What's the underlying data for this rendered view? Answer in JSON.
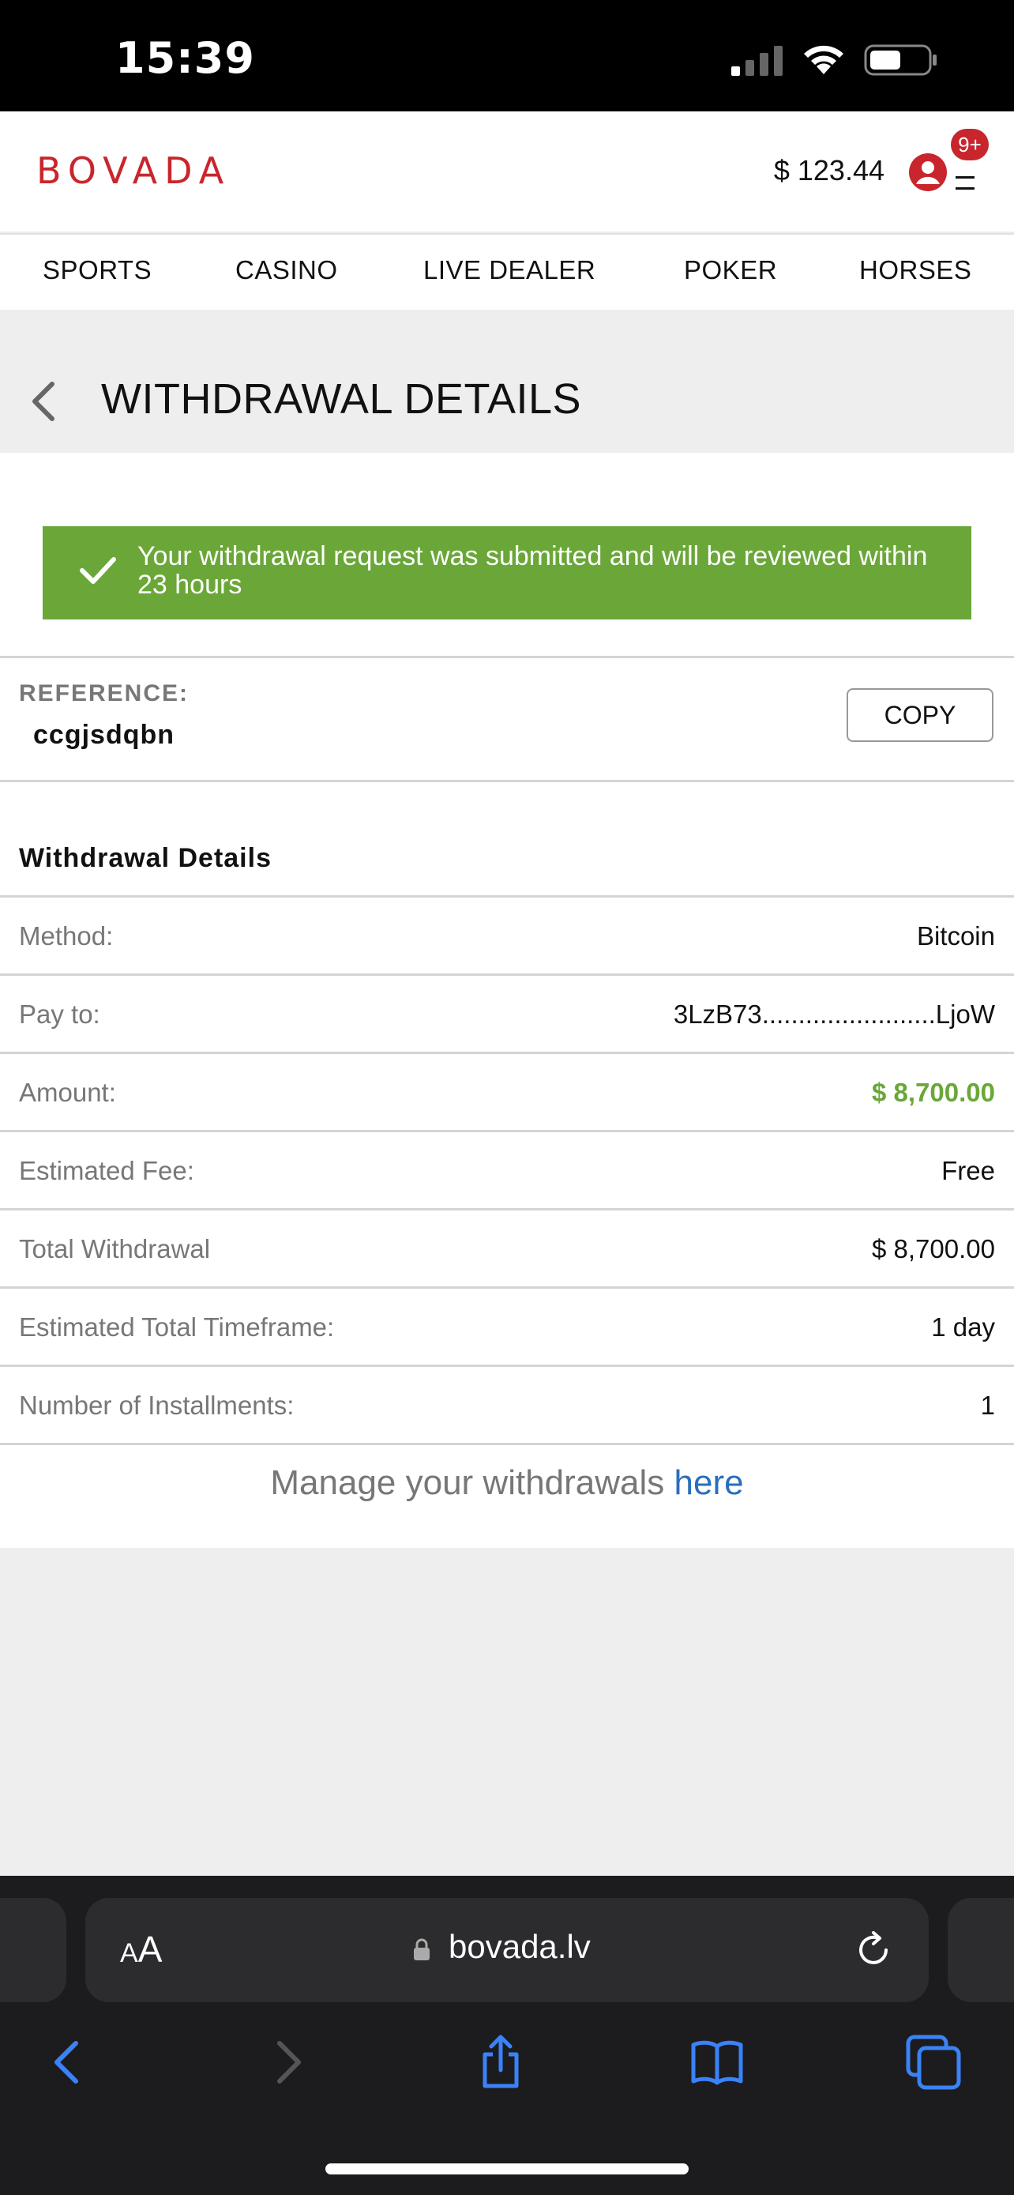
{
  "status_bar": {
    "time": "15:39",
    "icons": [
      "signal-icon",
      "wifi-icon",
      "battery-icon"
    ]
  },
  "header": {
    "logo": "BOVADA",
    "balance": "$ 123.44",
    "notification_badge": "9+",
    "brand_color": "#c8262c"
  },
  "nav": {
    "items": [
      {
        "label": "SPORTS"
      },
      {
        "label": "CASINO"
      },
      {
        "label": "LIVE DEALER"
      },
      {
        "label": "POKER"
      },
      {
        "label": "HORSES"
      }
    ]
  },
  "page": {
    "title": "WITHDRAWAL DETAILS"
  },
  "banner": {
    "message": "Your withdrawal request was submitted and will be reviewed within 23 hours",
    "color": "#6aa738"
  },
  "reference": {
    "label": "REFERENCE:",
    "value": "ccgjsdqbn",
    "copy_label": "COPY"
  },
  "details": {
    "heading": "Withdrawal Details",
    "rows": [
      {
        "label": "Method:",
        "value": "Bitcoin"
      },
      {
        "label": "Pay to:",
        "value": "3LzB73........................LjoW"
      },
      {
        "label": "Amount:",
        "value": "$ 8,700.00"
      },
      {
        "label": "Estimated Fee:",
        "value": "Free"
      },
      {
        "label": "Total Withdrawal",
        "value": "$ 8,700.00"
      },
      {
        "label": "Estimated Total Timeframe:",
        "value": "1 day"
      },
      {
        "label": "Number of Installments:",
        "value": "1"
      }
    ]
  },
  "manage": {
    "text": "Manage your withdrawals",
    "link": "here"
  },
  "safari": {
    "aa_small": "A",
    "aa_large": "A",
    "url": "bovada.lv",
    "toolbar": [
      "back-icon",
      "forward-icon",
      "share-icon",
      "bookmarks-icon",
      "tabs-icon"
    ]
  }
}
